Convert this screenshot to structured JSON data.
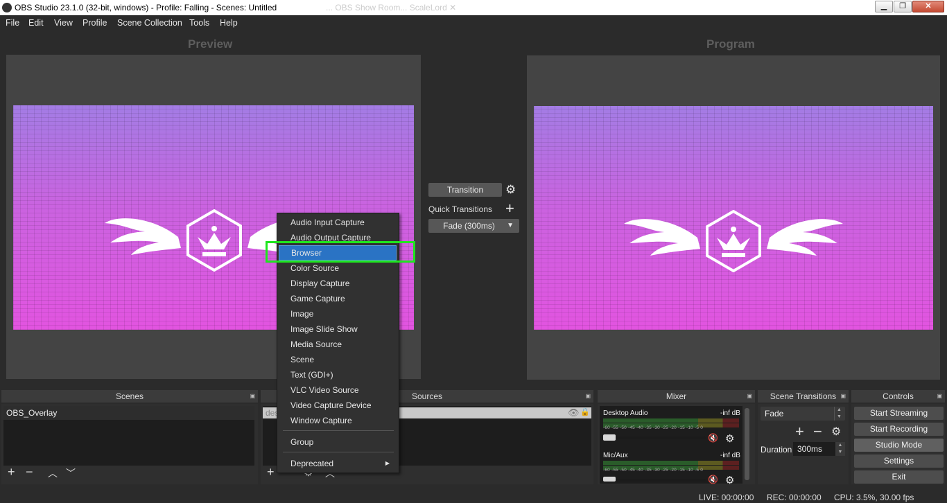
{
  "window": {
    "title": "OBS Studio 23.1.0 (32-bit, windows) - Profile: Falling - Scenes: Untitled",
    "background_tabs": "...  OBS Show Room...  ScaleLord  ✕",
    "minimize": "▁",
    "maximize": "❐",
    "close": "✕"
  },
  "menu": {
    "items": [
      "File",
      "Edit",
      "View",
      "Profile",
      "Scene Collection",
      "Tools",
      "Help"
    ]
  },
  "preview": {
    "title": "Preview"
  },
  "program": {
    "title": "Program"
  },
  "transition": {
    "button": "Transition",
    "quick_transitions": "Quick Transitions",
    "selected": "Fade (300ms)"
  },
  "context_menu": {
    "items": [
      "Audio Input Capture",
      "Audio Output Capture",
      "Browser",
      "Color Source",
      "Display Capture",
      "Game Capture",
      "Image",
      "Image Slide Show",
      "Media Source",
      "Scene",
      "Text (GDI+)",
      "VLC Video Source",
      "Video Capture Device",
      "Window Capture"
    ],
    "group": "Group",
    "deprecated": "Deprecated",
    "selected": "Browser"
  },
  "scenes": {
    "title": "Scenes",
    "items": [
      "OBS_Overlay"
    ]
  },
  "sources": {
    "title": "Sources",
    "first_item_partial": "des"
  },
  "mixer": {
    "title": "Mixer",
    "channels": [
      {
        "name": "Desktop Audio",
        "level": "-inf dB"
      },
      {
        "name": "Mic/Aux",
        "level": "-inf dB"
      }
    ],
    "scale": "-60 -55 -50 -45 -40 -35 -30 -25 -20 -15 -10 -5 0"
  },
  "scene_transitions": {
    "title": "Scene Transitions",
    "selected": "Fade",
    "duration_label": "Duration",
    "duration_value": "300ms"
  },
  "controls": {
    "title": "Controls",
    "buttons": [
      "Start Streaming",
      "Start Recording",
      "Studio Mode",
      "Settings",
      "Exit"
    ]
  },
  "status": {
    "live": "LIVE: 00:00:00",
    "rec": "REC: 00:00:00",
    "cpu": "CPU: 3.5%, 30.00 fps"
  },
  "colors": {
    "highlight_box": "#1ee61e",
    "menu_selection": "#2a73c4",
    "background": "#2b2b2b"
  }
}
